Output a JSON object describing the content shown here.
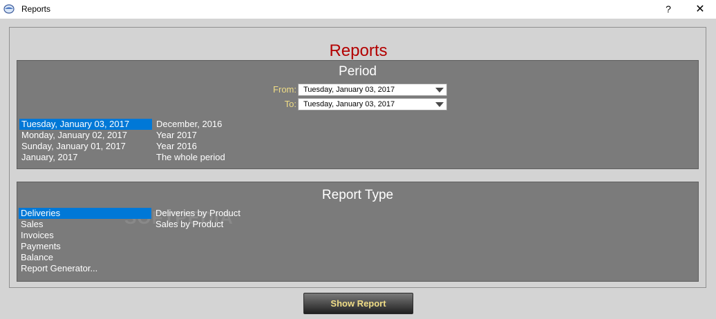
{
  "titlebar": {
    "title": "Reports",
    "help_label": "?",
    "close_label": "✕"
  },
  "heading": "Reports",
  "period": {
    "title": "Period",
    "from_label": "From:",
    "to_label": "To:",
    "from_value": "Tuesday, January 03, 2017",
    "to_value": "Tuesday, January 03, 2017",
    "list_left": [
      "Tuesday, January 03, 2017",
      "Monday, January 02, 2017",
      "Sunday, January 01, 2017",
      "January, 2017"
    ],
    "list_right": [
      "December, 2016",
      "Year 2017",
      "Year 2016",
      "The whole period"
    ]
  },
  "report_type": {
    "title": "Report Type",
    "list_left": [
      "Deliveries",
      "Sales",
      "Invoices",
      "Payments",
      "Balance",
      "Report Generator..."
    ],
    "list_right": [
      "Deliveries by Product",
      "Sales by Product"
    ]
  },
  "watermark": "SOFTPEDIA",
  "show_button": "Show Report",
  "colors": {
    "heading": "#b30000",
    "label": "#f0dd86",
    "selection": "#0078d7",
    "panel": "#7b7b7b"
  }
}
